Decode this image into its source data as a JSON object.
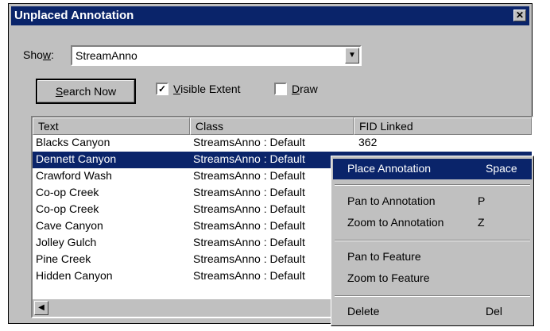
{
  "window": {
    "title": "Unplaced Annotation",
    "close_glyph": "✕"
  },
  "show": {
    "label_pre": "Sho",
    "label_u": "w",
    "label_post": ":",
    "value": "StreamAnno"
  },
  "search_button": {
    "u": "S",
    "rest": "earch Now"
  },
  "visible_extent": {
    "checked": true,
    "u": "V",
    "rest": "isible Extent"
  },
  "draw": {
    "checked": false,
    "u": "D",
    "rest": "raw"
  },
  "columns": [
    "Text",
    "Class",
    "FID Linked"
  ],
  "rows": [
    {
      "text": "Blacks Canyon",
      "class": "StreamsAnno : Default",
      "fid": "362"
    },
    {
      "text": "Dennett Canyon",
      "class": "StreamsAnno : Default",
      "fid": ""
    },
    {
      "text": "Crawford Wash",
      "class": "StreamsAnno : Default",
      "fid": ""
    },
    {
      "text": "Co-op Creek",
      "class": "StreamsAnno : Default",
      "fid": ""
    },
    {
      "text": "Co-op Creek",
      "class": "StreamsAnno : Default",
      "fid": ""
    },
    {
      "text": "Cave Canyon",
      "class": "StreamsAnno : Default",
      "fid": ""
    },
    {
      "text": "Jolley Gulch",
      "class": "StreamsAnno : Default",
      "fid": ""
    },
    {
      "text": "Pine Creek",
      "class": "StreamsAnno : Default",
      "fid": ""
    },
    {
      "text": "Hidden Canyon",
      "class": "StreamsAnno : Default",
      "fid": ""
    }
  ],
  "selected_row": 1,
  "context_menu": {
    "place": {
      "label": "Place Annotation",
      "key": "Space"
    },
    "pan_anno": {
      "label": "Pan to Annotation",
      "key": "P"
    },
    "zoom_anno": {
      "label": "Zoom to Annotation",
      "key": "Z"
    },
    "pan_feature": {
      "label": "Pan to Feature"
    },
    "zoom_feature": {
      "label": "Zoom to Feature"
    },
    "delete": {
      "label": "Delete",
      "key": "Del"
    }
  },
  "colors": {
    "title_bg": "#0a246a",
    "face": "#c0c0c0",
    "highlight": "#0a246a"
  }
}
